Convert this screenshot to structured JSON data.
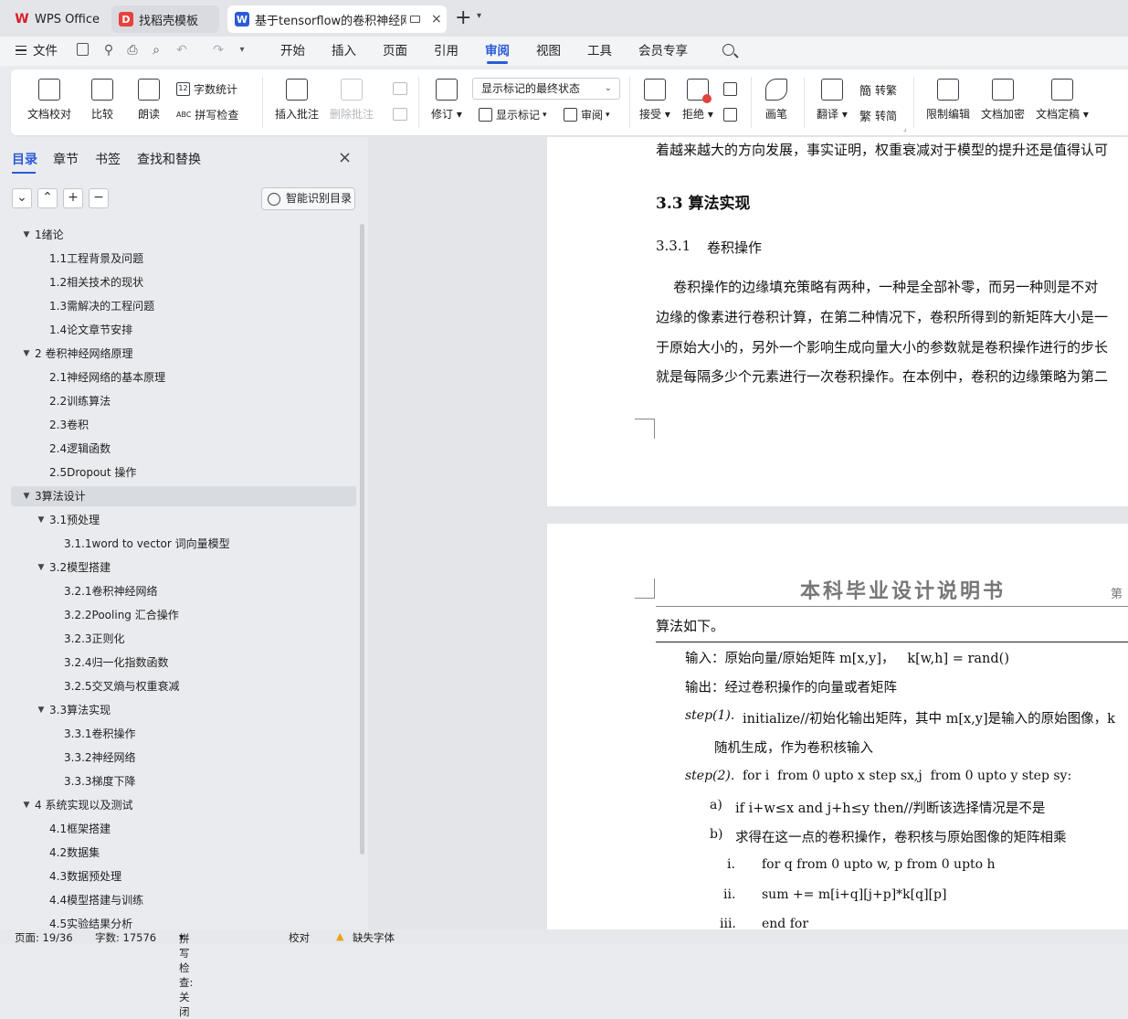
{
  "tabs": [
    {
      "label": "WPS Office",
      "icon": "wps-logo-icon"
    },
    {
      "label": "找稻壳模板",
      "icon": "docer-icon"
    },
    {
      "label": "基于tensorflow的卷积神经网",
      "icon": "writer-icon"
    }
  ],
  "menu": {
    "file": "文件",
    "items": [
      "开始",
      "插入",
      "页面",
      "引用",
      "审阅",
      "视图",
      "工具",
      "会员专享"
    ],
    "active": "审阅"
  },
  "ribbon": {
    "doc_check": "文档校对",
    "compare": "比较",
    "read_aloud": "朗读",
    "word_count": "字数统计",
    "spell_check": "拼写检查",
    "insert_comment": "插入批注",
    "delete_comment": "删除批注",
    "revise": "修订",
    "markup_select": "显示标记的最终状态",
    "show_markup": "显示标记",
    "review": "审阅",
    "accept": "接受",
    "reject": "拒绝",
    "pen": "画笔",
    "translate": "翻译",
    "to_traditional": "转繁",
    "to_simplified": "转简",
    "restrict_edit": "限制编辑",
    "encrypt": "文档加密",
    "finalize": "文档定稿"
  },
  "panel": {
    "tabs": [
      "目录",
      "章节",
      "书签",
      "查找和替换"
    ],
    "active_tab": "目录",
    "smart_toc": "智能识别目录",
    "toc": [
      {
        "label": "1绪论",
        "level": 0,
        "expanded": true
      },
      {
        "label": "1.1工程背景及问题",
        "level": 1
      },
      {
        "label": "1.2相关技术的现状",
        "level": 1
      },
      {
        "label": "1.3需解决的工程问题",
        "level": 1
      },
      {
        "label": "1.4论文章节安排",
        "level": 1
      },
      {
        "label": "2  卷积神经网络原理",
        "level": 0,
        "expanded": true
      },
      {
        "label": "2.1神经网络的基本原理",
        "level": 1
      },
      {
        "label": "2.2训练算法",
        "level": 1
      },
      {
        "label": "2.3卷积",
        "level": 1
      },
      {
        "label": "2.4逻辑函数",
        "level": 1
      },
      {
        "label": "2.5Dropout 操作",
        "level": 1
      },
      {
        "label": "3算法设计",
        "level": 0,
        "expanded": true,
        "selected": true
      },
      {
        "label": "3.1预处理",
        "level": 1,
        "expanded": true
      },
      {
        "label": "3.1.1word to vector 词向量模型",
        "level": 2
      },
      {
        "label": "3.2模型搭建",
        "level": 1,
        "expanded": true
      },
      {
        "label": "3.2.1卷积神经网络",
        "level": 2
      },
      {
        "label": "3.2.2Pooling 汇合操作",
        "level": 2
      },
      {
        "label": "3.2.3正则化",
        "level": 2
      },
      {
        "label": "3.2.4归一化指数函数",
        "level": 2
      },
      {
        "label": "3.2.5交叉熵与权重衰减",
        "level": 2
      },
      {
        "label": "3.3算法实现",
        "level": 1,
        "expanded": true
      },
      {
        "label": "3.3.1卷积操作",
        "level": 2
      },
      {
        "label": "3.3.2神经网络",
        "level": 2
      },
      {
        "label": "3.3.3梯度下降",
        "level": 2
      },
      {
        "label": "4  系统实现以及测试",
        "level": 0,
        "expanded": true
      },
      {
        "label": "4.1框架搭建",
        "level": 1
      },
      {
        "label": "4.2数据集",
        "level": 1
      },
      {
        "label": "4.3数据预处理",
        "level": 1
      },
      {
        "label": "4.4模型搭建与训练",
        "level": 1
      },
      {
        "label": "4.5实验结果分析",
        "level": 1
      }
    ]
  },
  "document": {
    "page1": {
      "line_top": "着越来越大的方向发展，事实证明，权重衰减对于模型的提升还是值得认可",
      "heading": "3.3 算法实现",
      "subheading_num": "3.3.1",
      "subheading_text": "卷积操作",
      "paragraph": [
        "    卷积操作的边缘填充策略有两种，一种是全部补零，而另一种则是不对",
        "边缘的像素进行卷积计算，在第二种情况下，卷积所得到的新矩阵大小是一",
        "于原始大小的，另外一个影响生成向量大小的参数就是卷积操作进行的步长",
        "就是每隔多少个元素进行一次卷积操作。在本例中，卷积的边缘策略为第二"
      ]
    },
    "page2": {
      "header_title": "本科毕业设计说明书",
      "header_right": "第",
      "lines": [
        "算法如下。",
        "输入：原始向量/原始矩阵 m[x,y]，   k[w,h] = rand()",
        "输出：经过卷积操作的向量或者矩阵",
        "step(1).",
        "initialize//初始化输出矩阵，其中 m[x,y]是输入的原始图像，k",
        "随机生成，作为卷积核输入",
        "step(2).",
        "for i  from 0 upto x step sx,j  from 0 upto y step sy:",
        "a)",
        "if i+w≤x and j+h≤y then//判断该选择情况是不是",
        "b)",
        "求得在这一点的卷积操作，卷积核与原始图像的矩阵相乘",
        "i.",
        "for q from 0 upto w, p from 0 upto h",
        "ii.",
        "sum += m[i+q][j+p]*k[q][p]",
        "iii.",
        "end for"
      ]
    }
  },
  "status": {
    "page": "页面: 19/36",
    "words": "字数: 17576",
    "spell": "拼写检查: 关闭",
    "proof": "校对",
    "missing_font": "缺失字体"
  }
}
